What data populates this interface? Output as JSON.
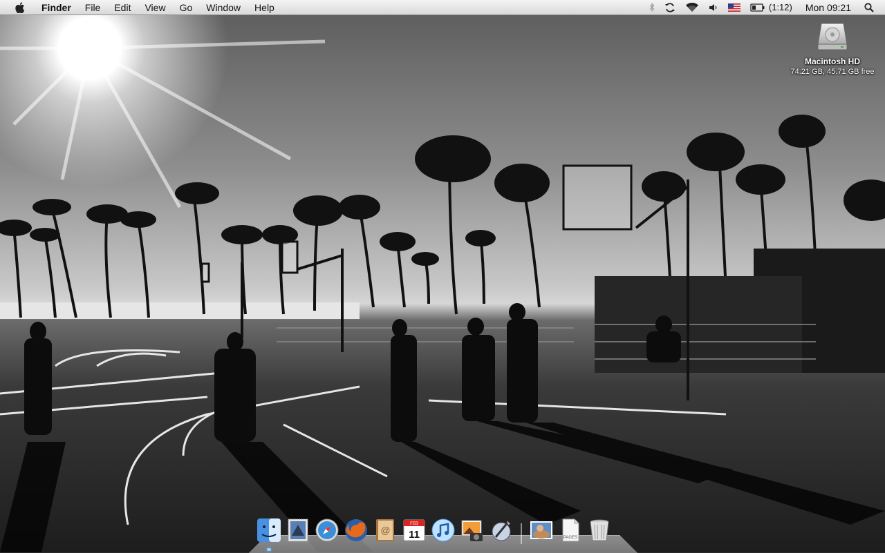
{
  "menubar": {
    "app_name": "Finder",
    "menus": [
      "File",
      "Edit",
      "View",
      "Go",
      "Window",
      "Help"
    ],
    "battery_time": "(1:12)",
    "clock": "Mon 09:21",
    "status_icons": [
      "bluetooth-icon",
      "time-machine-sync-icon",
      "wifi-icon",
      "volume-icon",
      "us-flag-input-icon",
      "battery-icon",
      "spotlight-search-icon"
    ]
  },
  "desktop": {
    "drive_name": "Macintosh HD",
    "drive_info": "74.21 GB, 45.71 GB free"
  },
  "dock": {
    "items": [
      "Finder",
      "Mail",
      "Safari",
      "Firefox",
      "Address Book",
      "iCal",
      "iTunes",
      "iPhoto",
      "Script Editor",
      "Photo",
      "Pages",
      "Trash"
    ],
    "ical_month": "FEB",
    "ical_day": "11",
    "pages_label": "PAGES"
  }
}
